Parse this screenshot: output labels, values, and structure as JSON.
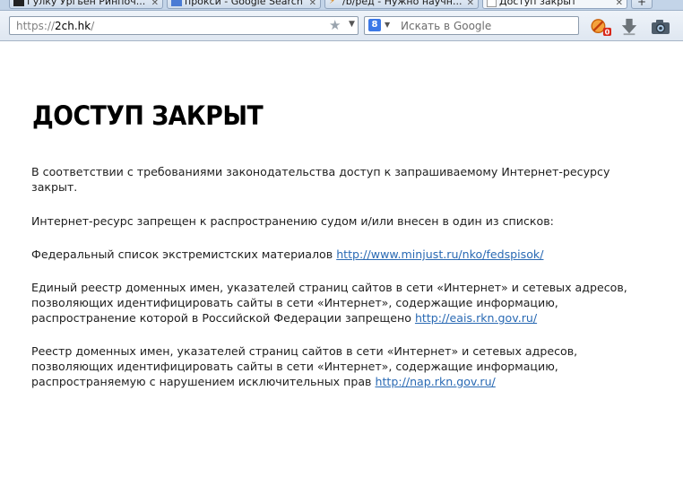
{
  "browser": {
    "tabs": [
      {
        "label": "Гулку Ургьен Ринпоч..."
      },
      {
        "label": "прокси - Google Search"
      },
      {
        "label": "/b/ред - Нужно научн..."
      },
      {
        "label": "Доступ закрыт"
      }
    ],
    "new_tab_label": "+",
    "url_scheme": "https://",
    "url_host": "2ch.hk",
    "url_path": "/",
    "search_engine_badge": "8",
    "search_placeholder": "Искать в Google",
    "adblock_count": "0",
    "colors": {
      "accent": "#3b78e7",
      "adblock": "#e8580c"
    }
  },
  "page": {
    "title": "ДОСТУП ЗАКРЫТ",
    "para1": "В соответствии с требованиями законодательства доступ к запрашиваемому Интернет-ресурсу закрыт.",
    "para2": "Интернет-ресурс запрещен к распространению судом и/или внесен в один из списков:",
    "para3_text": "Федеральный список экстремистских материалов ",
    "para3_link": "http://www.minjust.ru/nko/fedspisok/",
    "para4_text": "Единый реестр доменных имен, указателей страниц сайтов в сети «Интернет» и сетевых адресов, позволяющих идентифицировать сайты в сети «Интернет», содержащие информацию, распространение которой в Российской Федерации запрещено ",
    "para4_link": "http://eais.rkn.gov.ru/",
    "para5_text": "Реестр доменных имен, указателей страниц сайтов в сети «Интернет» и сетевых адресов, позволяющих идентифицировать сайты в сети «Интернет», содержащие информацию, распространяемую с нарушением исключительных прав ",
    "para5_link": "http://nap.rkn.gov.ru/"
  }
}
